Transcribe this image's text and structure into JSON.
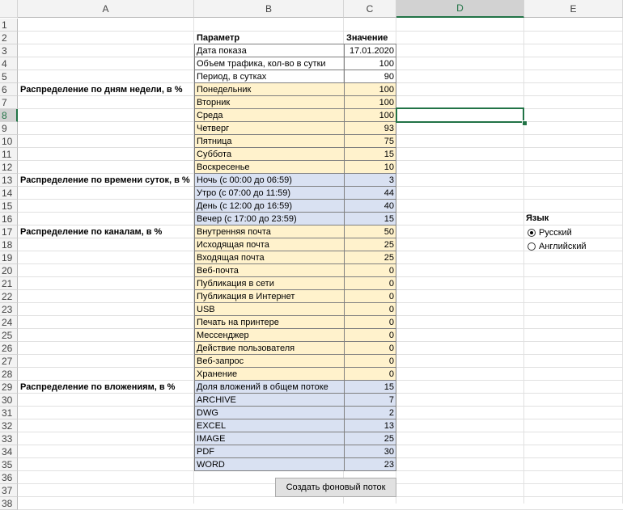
{
  "columns": [
    "A",
    "B",
    "C",
    "D",
    "E"
  ],
  "selected_column": "D",
  "selected_row": 8,
  "row_count": 38,
  "sections": [
    {
      "row": 6,
      "label": "Распределение по дням недели, в %"
    },
    {
      "row": 13,
      "label": "Распределение по времени суток, в %"
    },
    {
      "row": 17,
      "label": "Распределение по каналам, в %"
    },
    {
      "row": 29,
      "label": "Распределение по вложениям, в %"
    }
  ],
  "table": {
    "header": {
      "param": "Параметр",
      "value": "Значение"
    },
    "rows": [
      {
        "row": 3,
        "param": "Дата показа",
        "value": "17.01.2020",
        "fill": "none"
      },
      {
        "row": 4,
        "param": "Объем трафика, кол-во в сутки",
        "value": "100",
        "fill": "none"
      },
      {
        "row": 5,
        "param": "Период, в сутках",
        "value": "90",
        "fill": "none"
      },
      {
        "row": 6,
        "param": "Понедельник",
        "value": "100",
        "fill": "yellow"
      },
      {
        "row": 7,
        "param": "Вторник",
        "value": "100",
        "fill": "yellow"
      },
      {
        "row": 8,
        "param": "Среда",
        "value": "100",
        "fill": "yellow"
      },
      {
        "row": 9,
        "param": "Четверг",
        "value": "93",
        "fill": "yellow"
      },
      {
        "row": 10,
        "param": "Пятница",
        "value": "75",
        "fill": "yellow"
      },
      {
        "row": 11,
        "param": "Суббота",
        "value": "15",
        "fill": "yellow"
      },
      {
        "row": 12,
        "param": "Воскресенье",
        "value": "10",
        "fill": "yellow"
      },
      {
        "row": 13,
        "param": "Ночь (с 00:00 до 06:59)",
        "value": "3",
        "fill": "blue"
      },
      {
        "row": 14,
        "param": "Утро (с 07:00 до 11:59)",
        "value": "44",
        "fill": "blue"
      },
      {
        "row": 15,
        "param": "День (с 12:00 до 16:59)",
        "value": "40",
        "fill": "blue"
      },
      {
        "row": 16,
        "param": "Вечер (с 17:00 до 23:59)",
        "value": "15",
        "fill": "blue"
      },
      {
        "row": 17,
        "param": "Внутренняя почта",
        "value": "50",
        "fill": "yellow"
      },
      {
        "row": 18,
        "param": "Исходящая почта",
        "value": "25",
        "fill": "yellow"
      },
      {
        "row": 19,
        "param": "Входящая почта",
        "value": "25",
        "fill": "yellow"
      },
      {
        "row": 20,
        "param": "Веб-почта",
        "value": "0",
        "fill": "yellow"
      },
      {
        "row": 21,
        "param": "Публикация в сети",
        "value": "0",
        "fill": "yellow"
      },
      {
        "row": 22,
        "param": "Публикация в Интернет",
        "value": "0",
        "fill": "yellow"
      },
      {
        "row": 23,
        "param": "USB",
        "value": "0",
        "fill": "yellow"
      },
      {
        "row": 24,
        "param": "Печать на принтере",
        "value": "0",
        "fill": "yellow"
      },
      {
        "row": 25,
        "param": "Мессенджер",
        "value": "0",
        "fill": "yellow"
      },
      {
        "row": 26,
        "param": "Действие пользователя",
        "value": "0",
        "fill": "yellow"
      },
      {
        "row": 27,
        "param": "Веб-запрос",
        "value": "0",
        "fill": "yellow"
      },
      {
        "row": 28,
        "param": "Хранение",
        "value": "0",
        "fill": "yellow"
      },
      {
        "row": 29,
        "param": "Доля вложений в общем потоке",
        "value": "15",
        "fill": "blue"
      },
      {
        "row": 30,
        "param": "ARCHIVE",
        "value": "7",
        "fill": "blue"
      },
      {
        "row": 31,
        "param": "DWG",
        "value": "2",
        "fill": "blue"
      },
      {
        "row": 32,
        "param": "EXCEL",
        "value": "13",
        "fill": "blue"
      },
      {
        "row": 33,
        "param": "IMAGE",
        "value": "25",
        "fill": "blue"
      },
      {
        "row": 34,
        "param": "PDF",
        "value": "30",
        "fill": "blue"
      },
      {
        "row": 35,
        "param": "WORD",
        "value": "23",
        "fill": "blue"
      }
    ]
  },
  "language": {
    "title": "Язык",
    "options": [
      {
        "label": "Русский",
        "selected": true
      },
      {
        "label": "Английский",
        "selected": false
      }
    ]
  },
  "button": {
    "label": "Создать фоновый поток"
  },
  "colors": {
    "accent": "#217346",
    "yellow_fill": "#fff2cc",
    "blue_fill": "#d9e1f2"
  }
}
